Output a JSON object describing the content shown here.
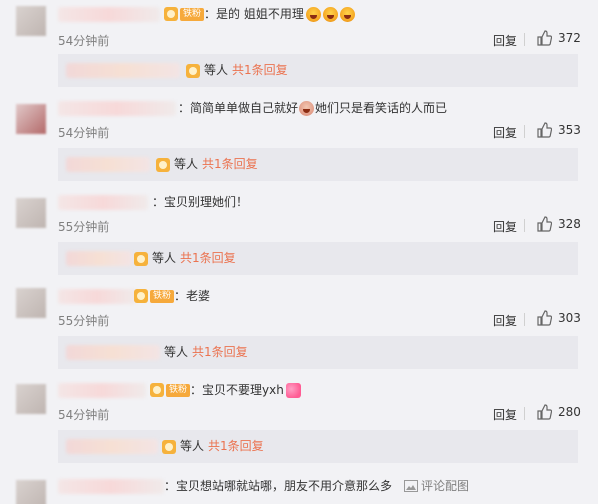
{
  "colors": {
    "background": "#f2f2f5",
    "accent": "#eb7350",
    "muted": "#808080"
  },
  "fan_badge_label": "铁粉",
  "reply_label": "回复",
  "comments": [
    {
      "text": "：是的 姐姐不用理",
      "time": "54分钟前",
      "likes": "372",
      "emoji_trailing": [
        "laugh-emoji",
        "laugh-emoji",
        "laugh-emoji"
      ],
      "sub": {
        "prefix": "等人",
        "count": "共1条回复"
      }
    },
    {
      "text": "：简简单单做自己就好",
      "text2": "她们只是看笑话的人而已",
      "time": "54分钟前",
      "likes": "353",
      "sub": {
        "prefix": "等人",
        "count": "共1条回复"
      }
    },
    {
      "text": "：宝贝别理她们！",
      "time": "55分钟前",
      "likes": "328",
      "sub": {
        "prefix": "等人",
        "count": "共1条回复"
      }
    },
    {
      "text": "：老婆",
      "time": "55分钟前",
      "likes": "303",
      "sub": {
        "prefix": "等人",
        "count": "共1条回复"
      }
    },
    {
      "text": "：宝贝不要理yxh",
      "time": "54分钟前",
      "likes": "280",
      "sub": {
        "prefix": "等人",
        "count": "共1条回复"
      }
    },
    {
      "text": "：宝贝想站哪就站哪，朋友不用介意那么多",
      "link": "评论配图"
    }
  ]
}
